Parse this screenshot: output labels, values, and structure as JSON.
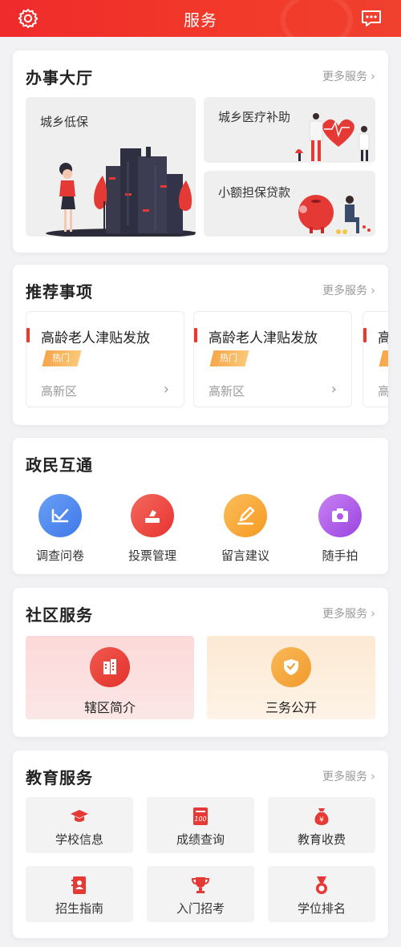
{
  "header": {
    "title": "服务",
    "left_icon": "settings-gear-icon",
    "right_icon": "message-dots-icon"
  },
  "hall": {
    "title": "办事大厅",
    "more": "更多服务",
    "tiles": [
      {
        "label": "城乡低保"
      },
      {
        "label": "城乡医疗补助"
      },
      {
        "label": "小额担保贷款"
      }
    ]
  },
  "recommend": {
    "title": "推荐事项",
    "more": "更多服务",
    "items": [
      {
        "title": "高龄老人津贴发放",
        "tag": "热门",
        "region": "高新区"
      },
      {
        "title": "高龄老人津贴发放",
        "tag": "热门",
        "region": "高新区"
      },
      {
        "title": "高龄老人津贴发放",
        "tag": "热门",
        "region": "高新区"
      }
    ]
  },
  "gov": {
    "title": "政民互通",
    "items": [
      {
        "label": "调查问卷",
        "icon": "survey-check-icon",
        "color": "#4f86f0"
      },
      {
        "label": "投票管理",
        "icon": "vote-box-icon",
        "color": "#ef3d3d"
      },
      {
        "label": "留言建议",
        "icon": "pencil-icon",
        "color": "#f7a12f"
      },
      {
        "label": "随手拍",
        "icon": "camera-icon",
        "color": "#b45de8"
      }
    ]
  },
  "community": {
    "title": "社区服务",
    "more": "更多服务",
    "tiles": [
      {
        "label": "辖区简介",
        "icon": "buildings-icon",
        "bg": "#fde0e0",
        "color": "#ec3b32"
      },
      {
        "label": "三务公开",
        "icon": "shield-badge-icon",
        "bg": "#fdf0e0",
        "color": "#f3a43a"
      }
    ]
  },
  "education": {
    "title": "教育服务",
    "more": "更多服务",
    "tiles": [
      {
        "label": "学校信息",
        "icon": "graduation-cap-icon"
      },
      {
        "label": "成绩查询",
        "icon": "score-100-icon"
      },
      {
        "label": "教育收费",
        "icon": "money-bag-icon"
      },
      {
        "label": "招生指南",
        "icon": "guide-book-icon"
      },
      {
        "label": "入门招考",
        "icon": "trophy-icon"
      },
      {
        "label": "学位排名",
        "icon": "medal-icon"
      }
    ]
  },
  "colors": {
    "accent": "#ef2b2b",
    "tag": "#f6a64a"
  }
}
